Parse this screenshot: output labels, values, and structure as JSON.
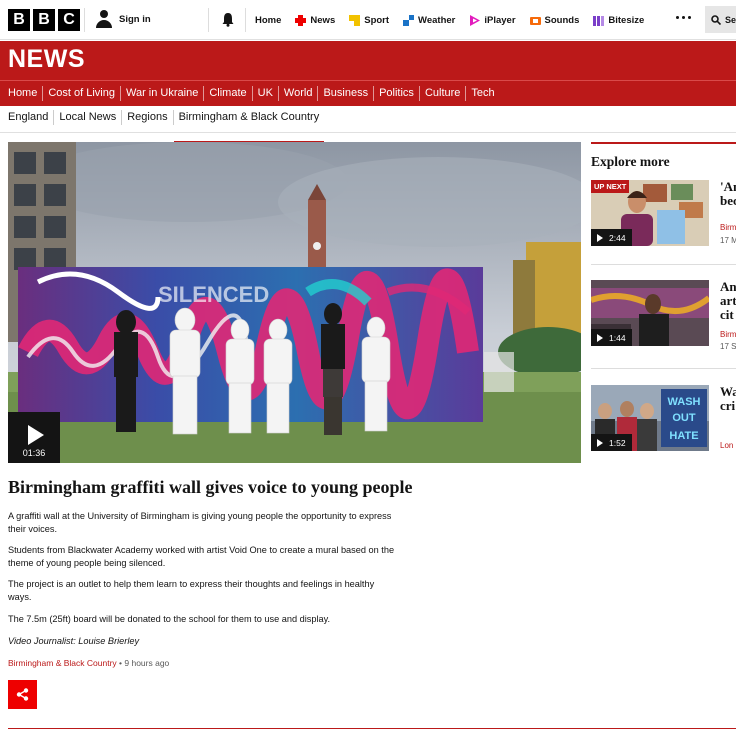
{
  "header": {
    "logo_letters": [
      "B",
      "B",
      "C"
    ],
    "signin_label": "Sign in",
    "nav": [
      {
        "label": "Home",
        "icon": "none"
      },
      {
        "label": "News",
        "icon": "news-icon",
        "color": "#e00"
      },
      {
        "label": "Sport",
        "icon": "sport-icon",
        "color": "#f2c200"
      },
      {
        "label": "Weather",
        "icon": "weather-icon",
        "color": "#1a73c7"
      },
      {
        "label": "iPlayer",
        "icon": "iplayer-icon",
        "color": "#e21cbd"
      },
      {
        "label": "Sounds",
        "icon": "sounds-icon",
        "color": "#f66a0a"
      },
      {
        "label": "Bitesize",
        "icon": "bitesize-icon",
        "color": "#7a3ec9"
      }
    ],
    "search_label": "Se"
  },
  "brand": {
    "title": "NEWS",
    "accent": "#bb1919"
  },
  "sections": [
    "Home",
    "Cost of Living",
    "War in Ukraine",
    "Climate",
    "UK",
    "World",
    "Business",
    "Politics",
    "Culture",
    "Tech"
  ],
  "active_section": "UK",
  "subsections": [
    "England",
    "Local News",
    "Regions",
    "Birmingham & Black Country"
  ],
  "active_subsection": "Birmingham & Black Country",
  "article": {
    "video_duration": "01:36",
    "headline": "Birmingham graffiti wall gives voice to young people",
    "paragraphs": [
      "A graffiti wall at the University of Birmingham is giving young people the opportunity to express their voices.",
      "Students from Blackwater Academy worked with artist Void One to create a mural based on the theme of young people being silenced.",
      "The project is an outlet to help them learn to express their thoughts and feelings in healthy ways.",
      "The 7.5m (25ft) board will be donated to the school for them to use and display."
    ],
    "credit": "Video Journalist: Louise Brierley",
    "tag": "Birmingham & Black Country",
    "time": "9 hours ago",
    "mural_text": "SILENCED"
  },
  "explore": {
    "title": "Explore more",
    "cards": [
      {
        "badge": "UP NEXT",
        "duration": "2:44",
        "title_lines": [
          "'An",
          "bec"
        ],
        "meta": "Birm",
        "date": "17 M"
      },
      {
        "badge": "",
        "duration": "1:44",
        "title_lines": [
          "An",
          "art",
          "cit"
        ],
        "meta": "Birm",
        "date": "17 S"
      },
      {
        "badge": "",
        "duration": "1:52",
        "title_lines": [
          "Wa",
          "cri"
        ],
        "meta": "Lon",
        "date": ""
      }
    ],
    "thumb3_text": [
      "WASH",
      "OUT",
      "HATE"
    ]
  }
}
